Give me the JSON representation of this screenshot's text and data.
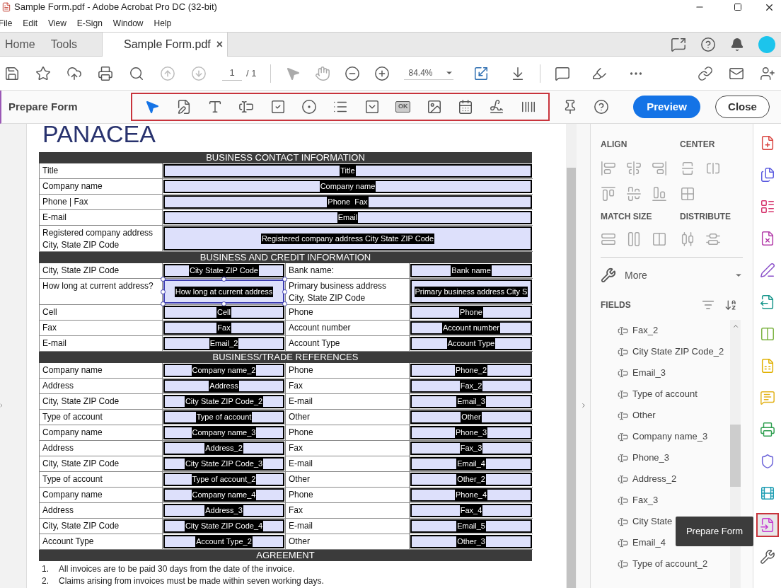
{
  "window": {
    "title": "Sample Form.pdf - Adobe Acrobat Pro DC (32-bit)"
  },
  "menu": [
    "File",
    "Edit",
    "View",
    "E-Sign",
    "Window",
    "Help"
  ],
  "tabs": [
    {
      "label": "Home",
      "selected": false
    },
    {
      "label": "Tools",
      "selected": false
    },
    {
      "label": "Sample Form.pdf",
      "selected": true,
      "close": "×"
    }
  ],
  "toolbar": {
    "page": "1",
    "page_total": "/ 1",
    "zoom": "84.4%"
  },
  "prepare_form": {
    "title": "Prepare Form",
    "tools": [
      {
        "kind": "select",
        "selected": true
      },
      {
        "kind": "edit",
        "selected": false
      },
      {
        "kind": "text",
        "selected": false
      },
      {
        "kind": "textfield",
        "selected": false
      },
      {
        "kind": "checkbox",
        "selected": false
      },
      {
        "kind": "radio",
        "selected": false
      },
      {
        "kind": "listbox",
        "selected": false
      },
      {
        "kind": "dropdown",
        "selected": false
      },
      {
        "kind": "button",
        "selected": false,
        "label": "OK"
      },
      {
        "kind": "image",
        "selected": false
      },
      {
        "kind": "date",
        "selected": false
      },
      {
        "kind": "signature",
        "selected": false
      },
      {
        "kind": "barcode",
        "selected": false
      }
    ],
    "preview": "Preview",
    "close": "Close"
  },
  "document": {
    "logo": "PANACEA",
    "sections": [
      {
        "heading": "BUSINESS CONTACT INFORMATION",
        "rows": [
          {
            "kind": "wide",
            "label": "Title",
            "field": {
              "value": "Title",
              "selected": false
            }
          },
          {
            "kind": "wide",
            "label": "Company name",
            "field": {
              "value": "Company name",
              "selected": false
            }
          },
          {
            "kind": "wide",
            "label": "Phone | Fax",
            "field": {
              "value": "Phone  Fax",
              "selected": false
            }
          },
          {
            "kind": "wide",
            "label": "E-mail",
            "field": {
              "value": "Email",
              "selected": false
            }
          },
          {
            "kind": "wide",
            "label": "Registered company address\nCity, State ZIP Code",
            "field": {
              "value": "Registered company address City State ZIP Code",
              "selected": false
            }
          }
        ]
      },
      {
        "heading": "BUSINESS AND CREDIT INFORMATION",
        "rows": [
          {
            "kind": "quad",
            "label": "City, State ZIP Code",
            "field": {
              "value": "City State ZIP Code",
              "selected": false
            },
            "label_2": "Bank name:",
            "field_2": {
              "value": "Bank name",
              "selected": false
            }
          },
          {
            "kind": "quad",
            "label": "How long at current address?",
            "field": {
              "value": "How long at current address",
              "selected": true
            },
            "label_2": "Primary business address\nCity, State ZIP Code",
            "field_2": {
              "value": "Primary business address City S",
              "selected": false
            }
          },
          {
            "kind": "quad",
            "label": "Cell",
            "field": {
              "value": "Cell",
              "selected": false
            },
            "label_2": "Phone",
            "field_2": {
              "value": "Phone",
              "selected": false
            }
          },
          {
            "kind": "quad",
            "label": "Fax",
            "field": {
              "value": "Fax",
              "selected": false
            },
            "label_2": "Account number",
            "field_2": {
              "value": "Account number",
              "selected": false
            }
          },
          {
            "kind": "quad",
            "label": "E-mail",
            "field": {
              "value": "Email_2",
              "selected": false
            },
            "label_2": "Account Type",
            "field_2": {
              "value": "Account Type",
              "selected": false
            }
          }
        ]
      },
      {
        "heading": "BUSINESS/TRADE REFERENCES",
        "rows": [
          {
            "kind": "quad",
            "label": "Company name",
            "field": {
              "value": "Company name_2",
              "selected": false
            },
            "label_2": "Phone",
            "field_2": {
              "value": "Phone_2",
              "selected": false
            }
          },
          {
            "kind": "quad",
            "label": "Address",
            "field": {
              "value": "Address",
              "selected": false
            },
            "label_2": "Fax",
            "field_2": {
              "value": "Fax_2",
              "selected": false
            }
          },
          {
            "kind": "quad",
            "label": "City, State ZIP Code",
            "field": {
              "value": "City State ZIP Code_2",
              "selected": false
            },
            "label_2": "E-mail",
            "field_2": {
              "value": "Email_3",
              "selected": false
            }
          },
          {
            "kind": "quad",
            "label": "Type of account",
            "field": {
              "value": "Type of account",
              "selected": false
            },
            "label_2": "Other",
            "field_2": {
              "value": "Other",
              "selected": false
            }
          },
          {
            "kind": "quad",
            "label": "Company name",
            "field": {
              "value": "Company name_3",
              "selected": false
            },
            "label_2": "Phone",
            "field_2": {
              "value": "Phone_3",
              "selected": false
            }
          },
          {
            "kind": "quad",
            "label": "Address",
            "field": {
              "value": "Address_2",
              "selected": false
            },
            "label_2": "Fax",
            "field_2": {
              "value": "Fax_3",
              "selected": false
            }
          },
          {
            "kind": "quad",
            "label": "City, State ZIP Code",
            "field": {
              "value": "City State ZIP Code_3",
              "selected": false
            },
            "label_2": "E-mail",
            "field_2": {
              "value": "Email_4",
              "selected": false
            }
          },
          {
            "kind": "quad",
            "label": "Type of account",
            "field": {
              "value": "Type of account_2",
              "selected": false
            },
            "label_2": "Other",
            "field_2": {
              "value": "Other_2",
              "selected": false
            }
          },
          {
            "kind": "quad",
            "label": "Company name",
            "field": {
              "value": "Company name_4",
              "selected": false
            },
            "label_2": "Phone",
            "field_2": {
              "value": "Phone_4",
              "selected": false
            }
          },
          {
            "kind": "quad",
            "label": "Address",
            "field": {
              "value": "Address_3",
              "selected": false
            },
            "label_2": "Fax",
            "field_2": {
              "value": "Fax_4",
              "selected": false
            }
          },
          {
            "kind": "quad",
            "label": "City, State ZIP Code",
            "field": {
              "value": "City State ZIP Code_4",
              "selected": false
            },
            "label_2": "E-mail",
            "field_2": {
              "value": "Email_5",
              "selected": false
            }
          },
          {
            "kind": "quad",
            "label": "Account Type",
            "field": {
              "value": "Account Type_2",
              "selected": false
            },
            "label_2": "Other",
            "field_2": {
              "value": "Other_3",
              "selected": false
            }
          }
        ]
      },
      {
        "heading": "AGREEMENT"
      }
    ],
    "agreement": [
      {
        "number": "1.",
        "text": "All invoices are to be paid 30 days from the date of the invoice."
      },
      {
        "number": "2.",
        "text": "Claims arising from invoices must be made within seven working days."
      }
    ]
  },
  "panel": {
    "align": "ALIGN",
    "center": "CENTER",
    "match_size": "MATCH SIZE",
    "distribute": "DISTRIBUTE",
    "more": "More",
    "fields_heading": "FIELDS",
    "fields": [
      "Fax_2",
      "City State ZIP Code_2",
      "Email_3",
      "Type of account",
      "Other",
      "Company name_3",
      "Phone_3",
      "Address_2",
      "Fax_3",
      "City State",
      "Email_4",
      "Type of account_2"
    ]
  },
  "tool_rail": [
    {
      "kind": "create",
      "color": "#d9443f",
      "selected": false
    },
    {
      "kind": "combine",
      "color": "#5c5ce0",
      "selected": false
    },
    {
      "kind": "organize",
      "color": "#d6336c",
      "selected": false
    },
    {
      "kind": "edit",
      "color": "#b23aa8",
      "selected": false
    },
    {
      "kind": "sign",
      "color": "#8a4fc9",
      "selected": false
    },
    {
      "kind": "export",
      "color": "#16958a",
      "selected": false
    },
    {
      "kind": "compare",
      "color": "#7cb342",
      "selected": false
    },
    {
      "kind": "document",
      "color": "#e0b000",
      "selected": false
    },
    {
      "kind": "comment",
      "color": "#e3b31b",
      "selected": false
    },
    {
      "kind": "scan",
      "color": "#2e9e4f",
      "selected": false
    },
    {
      "kind": "protect",
      "color": "#6b63d9",
      "selected": false
    },
    {
      "kind": "media",
      "color": "#1d9db3",
      "selected": false
    },
    {
      "kind": "prepare",
      "color": "#c53bd1",
      "selected": true
    },
    {
      "kind": "more",
      "color": "#555555",
      "selected": false
    }
  ],
  "tooltip": "Prepare Form"
}
